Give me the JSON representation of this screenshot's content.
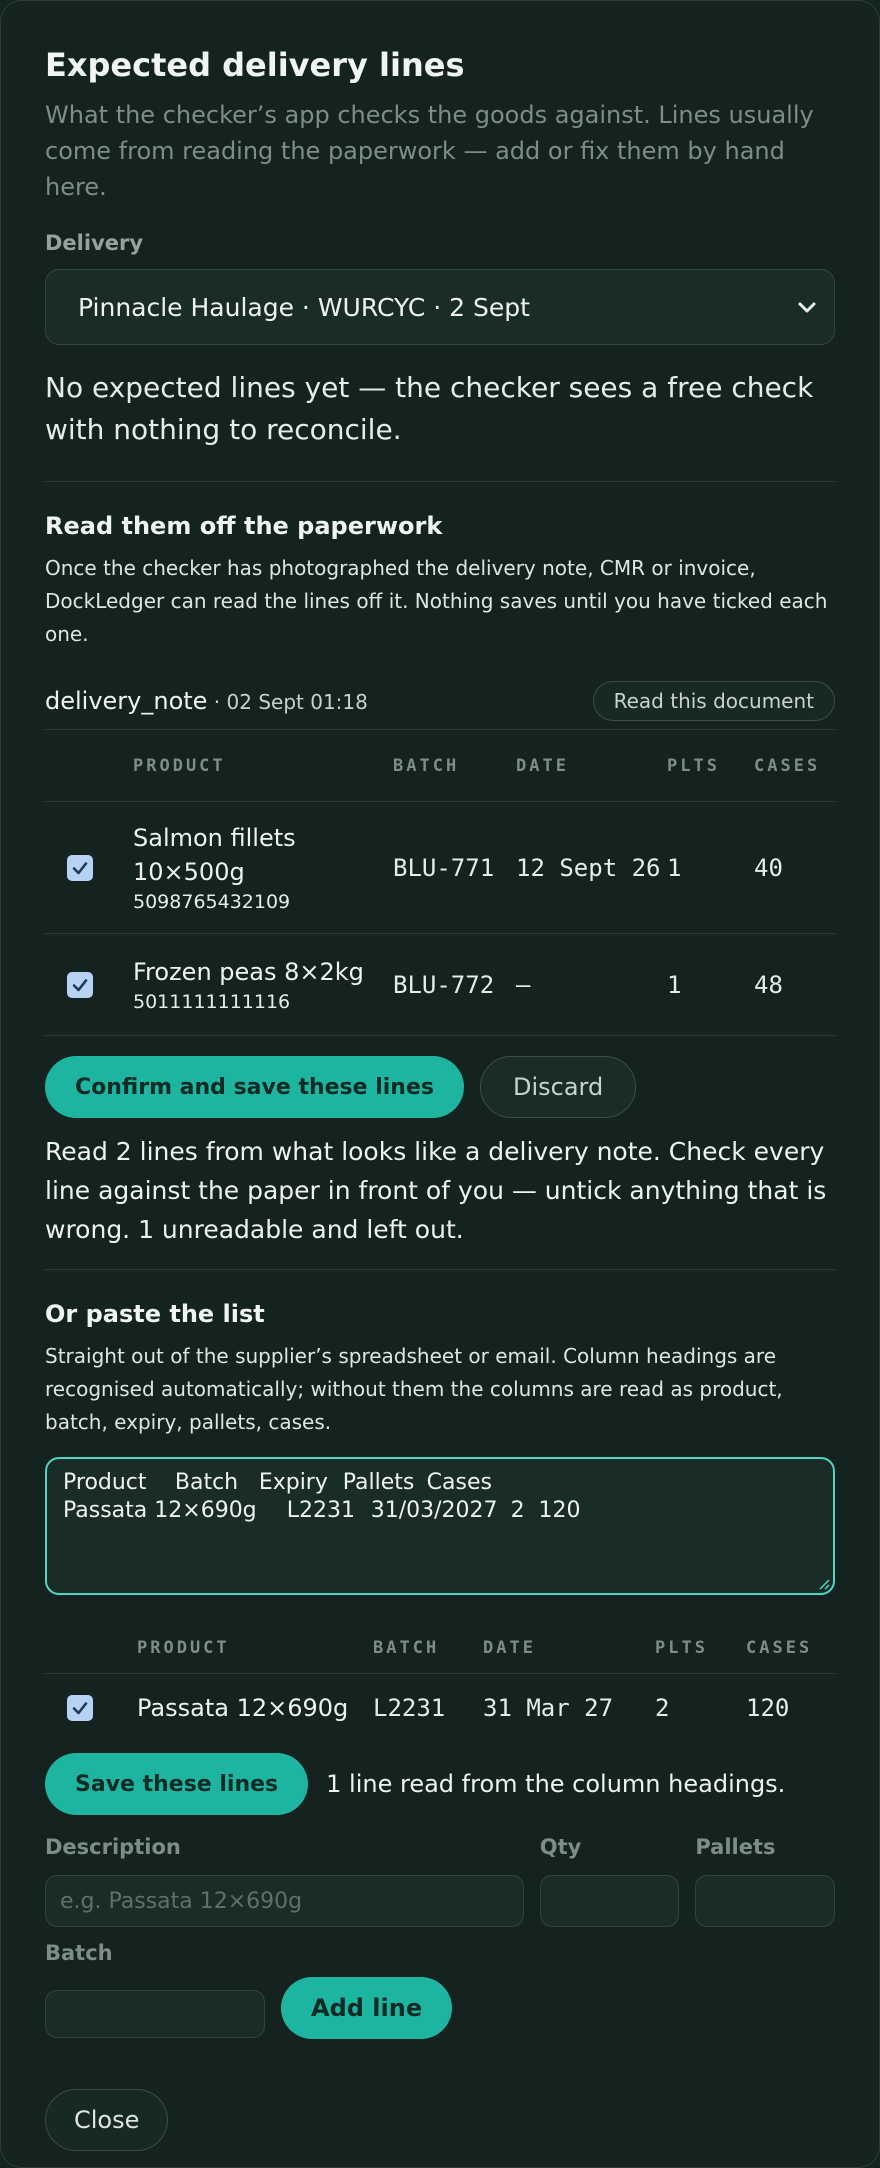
{
  "dialog": {
    "title": "Expected delivery lines",
    "subtitle": "What the checker’s app checks the goods against. Lines usually come from reading the paperwork — add or fix them by hand here."
  },
  "delivery": {
    "label": "Delivery",
    "selected": "Pinnacle Haulage · WURCYC · 2 Sept"
  },
  "empty_note": "No expected lines yet — the checker sees a free check with nothing to reconcile.",
  "paperwork": {
    "title": "Read them off the paperwork",
    "description": "Once the checker has photographed the delivery note, CMR or invoice, DockLedger can read the lines off it. Nothing saves until you have ticked each one.",
    "document_name": "delivery_note",
    "document_meta": " · 02 Sept 01:18",
    "read_button": "Read this document",
    "columns": [
      "PRODUCT",
      "BATCH",
      "DATE",
      "PLTS",
      "CASES"
    ],
    "rows": [
      {
        "checked": true,
        "product": "Salmon fillets 10×500g",
        "ean": "5098765432109",
        "batch": "BLU-771",
        "date": "12 Sept 26",
        "plts": "1",
        "cases": "40"
      },
      {
        "checked": true,
        "product": "Frozen peas 8×2kg",
        "ean": "5011111111116",
        "batch": "BLU-772",
        "date": "—",
        "plts": "1",
        "cases": "48"
      }
    ],
    "confirm_button": "Confirm and save these lines",
    "discard_button": "Discard",
    "result_text": "Read 2 lines from what looks like a delivery note. Check every line against the paper in front of you — untick anything that is wrong. 1 unreadable and left out."
  },
  "paste": {
    "title": "Or paste the list",
    "description": "Straight out of the supplier’s spreadsheet or email. Column headings are recognised automatically; without them the columns are read as product, batch, expiry, pallets, cases.",
    "textarea_line1": "Product\tBatch\tExpiry\tPallets\tCases",
    "textarea_line2": "Passata 12×690g\tL2231\t31/03/2027\t2\t120",
    "columns": [
      "PRODUCT",
      "BATCH",
      "DATE",
      "PLTS",
      "CASES"
    ],
    "rows": [
      {
        "checked": true,
        "product": "Passata 12×690g",
        "batch": "L2231",
        "date": "31 Mar 27",
        "plts": "2",
        "cases": "120"
      }
    ],
    "save_button": "Save these lines",
    "save_note": "1 line read from the column headings."
  },
  "manual": {
    "description_label": "Description",
    "description_placeholder": "e.g. Passata 12×690g",
    "qty_label": "Qty",
    "pallets_label": "Pallets",
    "batch_label": "Batch",
    "add_button": "Add line"
  },
  "close_button": "Close"
}
